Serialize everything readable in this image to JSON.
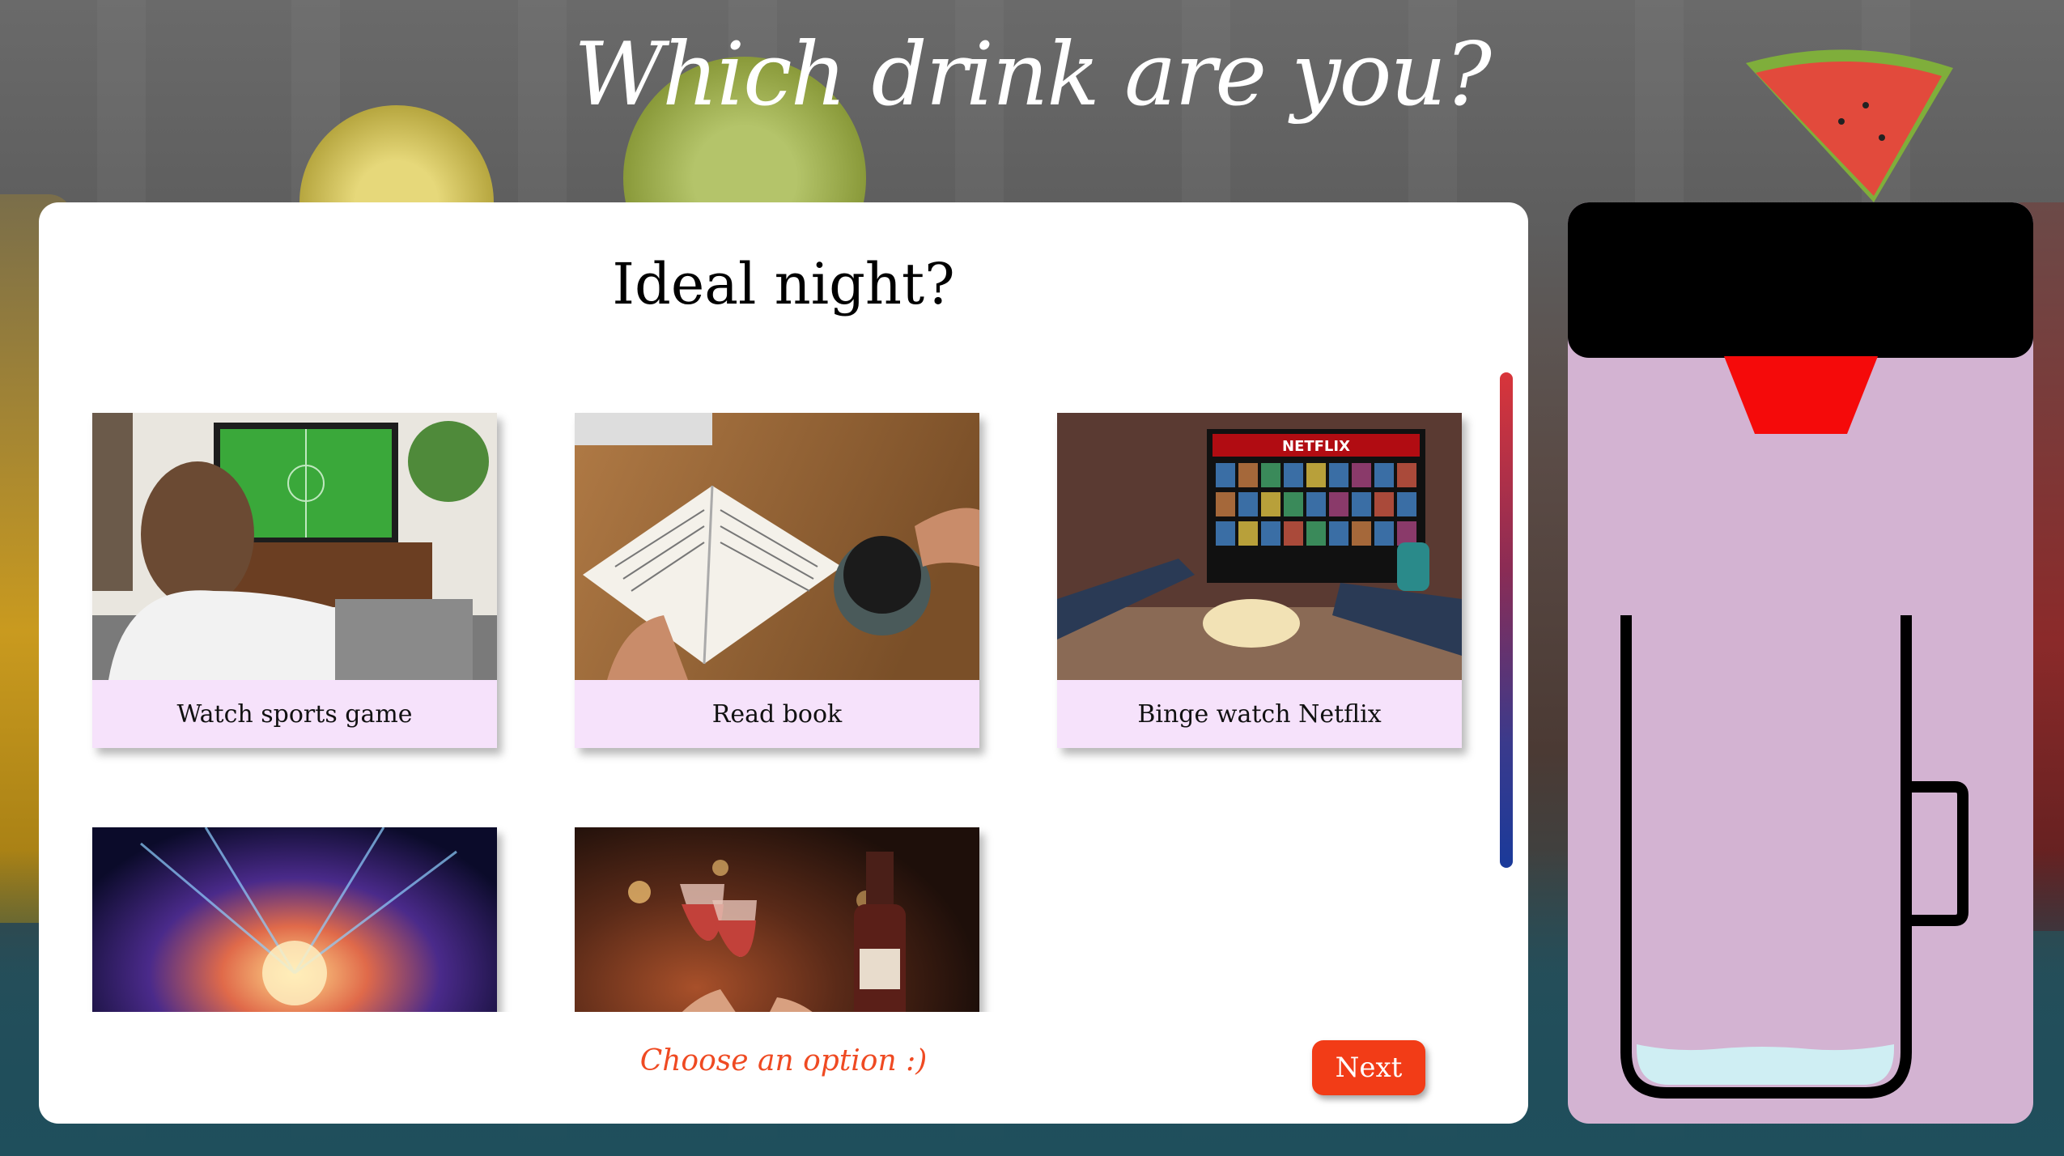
{
  "title": "Which drink are you?",
  "question": "Ideal night?",
  "options": [
    {
      "label": "Watch sports game",
      "image": "tv-sports-photo"
    },
    {
      "label": "Read book",
      "image": "book-coffee-photo"
    },
    {
      "label": "Binge watch Netflix",
      "image": "netflix-photo"
    },
    {
      "label": "",
      "image": "concert-photo"
    },
    {
      "label": "",
      "image": "wine-dinner-photo"
    }
  ],
  "status_text": "Choose an option :)",
  "next_label": "Next",
  "colors": {
    "accent": "#f23c17",
    "caption_bg": "#f6e2fb",
    "glass_panel": "#d3b3d2",
    "lid": "#000000",
    "drop": "#f50a0a",
    "liquid": "#cfeef3"
  }
}
